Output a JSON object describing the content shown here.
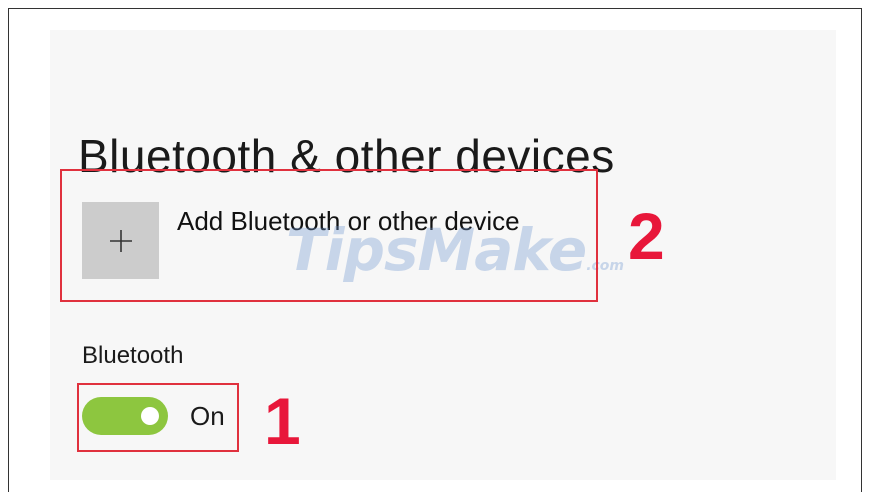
{
  "page": {
    "title": "Bluetooth & other devices"
  },
  "add_device": {
    "label": "Add Bluetooth or other device",
    "icon": "plus-icon"
  },
  "bluetooth": {
    "section_label": "Bluetooth",
    "toggle_state": "On",
    "toggle_on": true
  },
  "annotations": {
    "step_add_device": "2",
    "step_toggle": "1"
  },
  "watermark": {
    "text": "TipsMake",
    "suffix": ".com"
  },
  "colors": {
    "toggle_on": "#8dc63f",
    "highlight_border": "#e0313e",
    "callout_number": "#e8173a",
    "add_tile": "#cccccc",
    "panel_bg": "#f7f7f7"
  }
}
